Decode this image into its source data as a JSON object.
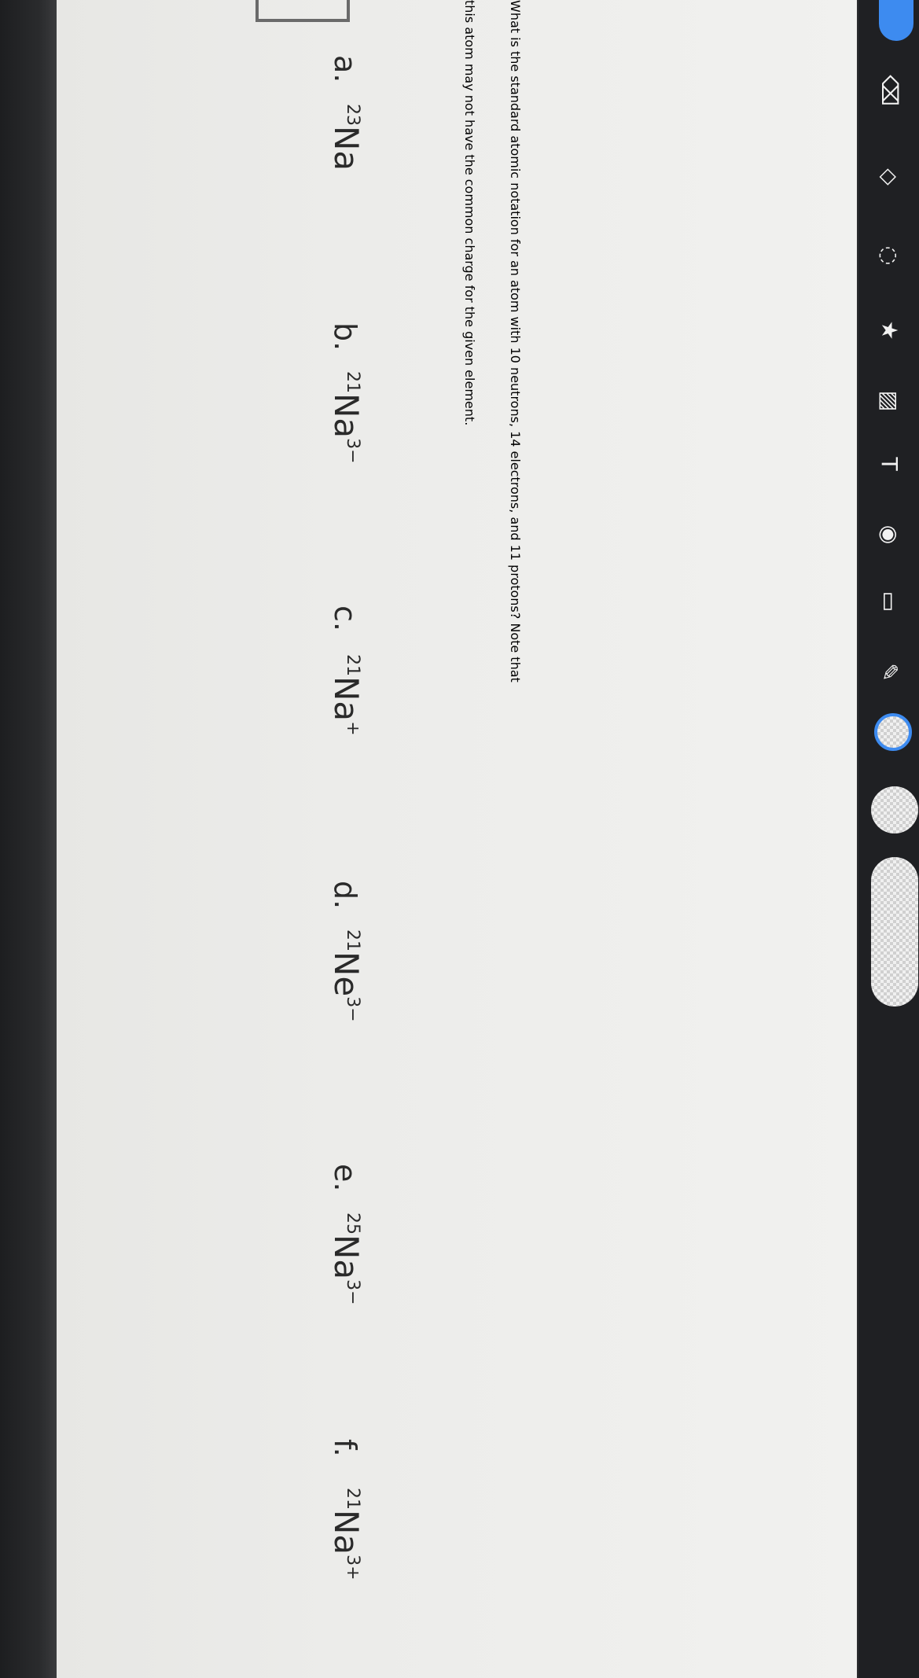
{
  "question": {
    "line1": "What is the standard atomic notation for an atom with 10 neutrons, 14 electrons, and 11 protons? Note that",
    "line2": "this atom may not have the common charge for the given element."
  },
  "options": [
    {
      "letter": "a.",
      "mass": "23",
      "symbol": "Na",
      "charge": ""
    },
    {
      "letter": "b.",
      "mass": "21",
      "symbol": "Na",
      "charge": "3−"
    },
    {
      "letter": "c.",
      "mass": "21",
      "symbol": "Na",
      "charge": "+"
    },
    {
      "letter": "d.",
      "mass": "21",
      "symbol": "Ne",
      "charge": "3−"
    },
    {
      "letter": "e.",
      "mass": "25",
      "symbol": "Na",
      "charge": "3−"
    },
    {
      "letter": "f.",
      "mass": "21",
      "symbol": "Na",
      "charge": "3+"
    }
  ],
  "toolbar": {
    "tools": [
      "eraser-icon",
      "shapes-icon",
      "lasso-icon",
      "sticker-icon",
      "image-icon",
      "text-icon",
      "camera-icon",
      "ruler-icon",
      "magic-pen-icon"
    ],
    "accent": "#3d8bf0"
  }
}
